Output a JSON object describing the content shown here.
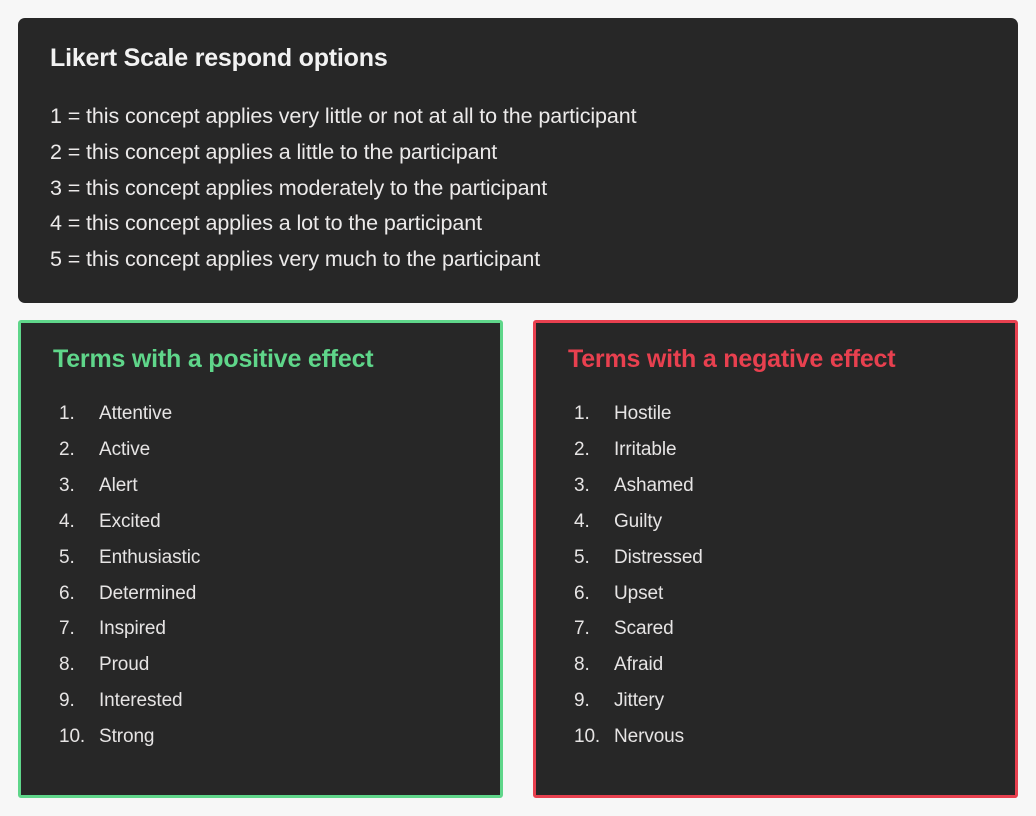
{
  "colors": {
    "page_background": "#f7f7f7",
    "card_background": "#272727",
    "text": "#e6e4e4",
    "positive_accent": "#5fd68a",
    "negative_accent": "#e8404f"
  },
  "likert": {
    "title": "Likert Scale respond options",
    "lines": [
      "1 = this concept applies very little or not at all to the participant",
      "2 = this concept applies a little to the participant",
      "3 = this concept applies moderately to the participant",
      "4 = this concept applies a lot to the participant",
      "5 = this concept applies very much to the participant"
    ]
  },
  "positive_panel": {
    "title": "Terms with a positive effect",
    "items": [
      {
        "index": "1.",
        "label": "Attentive"
      },
      {
        "index": "2.",
        "label": "Active"
      },
      {
        "index": "3.",
        "label": "Alert"
      },
      {
        "index": "4.",
        "label": "Excited"
      },
      {
        "index": "5.",
        "label": "Enthusiastic"
      },
      {
        "index": "6.",
        "label": "Determined"
      },
      {
        "index": "7.",
        "label": "Inspired"
      },
      {
        "index": "8.",
        "label": "Proud"
      },
      {
        "index": "9.",
        "label": "Interested"
      },
      {
        "index": "10.",
        "label": "Strong"
      }
    ]
  },
  "negative_panel": {
    "title": "Terms with a negative effect",
    "items": [
      {
        "index": "1.",
        "label": "Hostile"
      },
      {
        "index": "2.",
        "label": "Irritable"
      },
      {
        "index": "3.",
        "label": "Ashamed"
      },
      {
        "index": "4.",
        "label": "Guilty"
      },
      {
        "index": "5.",
        "label": "Distressed"
      },
      {
        "index": "6.",
        "label": "Upset"
      },
      {
        "index": "7.",
        "label": "Scared"
      },
      {
        "index": "8.",
        "label": "Afraid"
      },
      {
        "index": "9.",
        "label": "Jittery"
      },
      {
        "index": "10.",
        "label": "Nervous"
      }
    ]
  }
}
